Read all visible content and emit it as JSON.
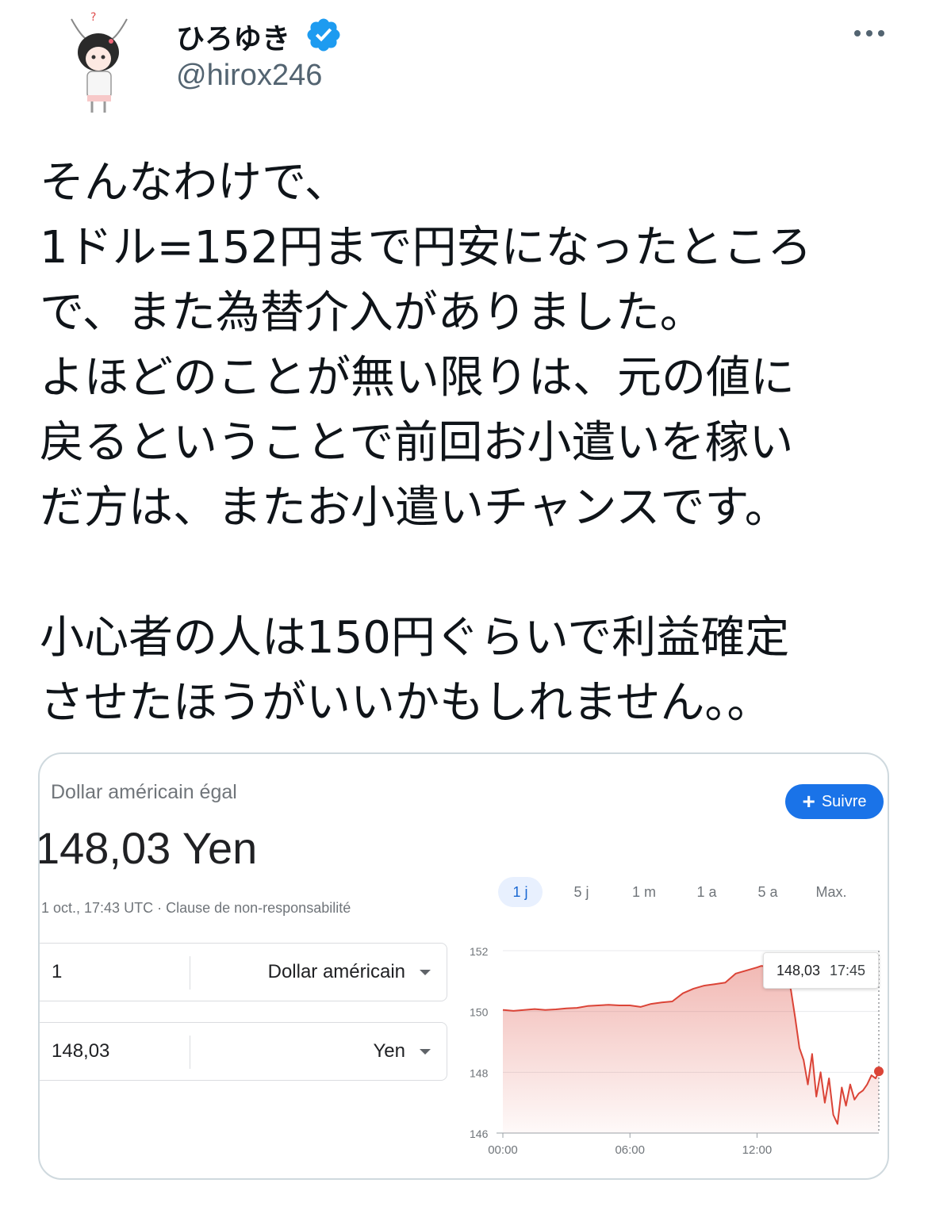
{
  "author": {
    "name": "ひろゆき",
    "handle": "@hirox246",
    "avatar_icon": "avatar-illustration",
    "verified_icon": "verified-badge-icon",
    "verified_color": "#1d9bf0"
  },
  "more_icon": "more-icon",
  "tweet": {
    "lines": [
      "そんなわけで、",
      "1ドル=152円まで円安になったところ",
      "で、また為替介入がありました。",
      "よほどのことが無い限りは、元の値に",
      "戻るということで前回お小遣いを稼い",
      "だ方は、またお小遣いチャンスです。",
      "",
      "小心者の人は150円ぐらいで利益確定",
      "させたほうがいいかもしれません。。"
    ]
  },
  "card": {
    "title": "Dollar américain égal",
    "price": "148,03 Yen",
    "timestamp": "1 oct., 17:43 UTC",
    "separator": " · ",
    "disclaimer": "Clause de non-responsabilité",
    "follow_label": "Suivre",
    "follow_color": "#1a73e8",
    "converter": [
      {
        "value": "1",
        "unit": "Dollar américain"
      },
      {
        "value": "148,03",
        "unit": "Yen"
      }
    ],
    "ranges": [
      "1 j",
      "5 j",
      "1 m",
      "1 a",
      "5 a",
      "Max."
    ],
    "active_range": "1 j",
    "tooltip": {
      "value": "148,03",
      "time": "17:45"
    }
  },
  "chart_data": {
    "type": "area",
    "color": "#db4437",
    "ylim": [
      146,
      152
    ],
    "yticks": [
      "152",
      "150",
      "148",
      "146"
    ],
    "xticks": [
      "00:00",
      "06:00",
      "12:00"
    ],
    "xrange_hours": [
      0,
      17.75
    ],
    "series": [
      {
        "x": [
          0,
          0.5,
          1,
          1.5,
          2,
          2.5,
          3,
          3.5,
          4,
          4.5,
          5,
          5.5,
          6,
          6.5,
          7,
          7.5,
          8,
          8.5,
          9,
          9.5,
          10,
          10.5,
          11,
          11.5,
          12,
          12.2,
          12.5,
          12.7,
          13,
          13.2,
          13.4,
          13.6,
          13.8,
          14,
          14.2,
          14.4,
          14.6,
          14.8,
          15,
          15.2,
          15.4,
          15.6,
          15.8,
          16,
          16.2,
          16.4,
          16.6,
          16.8,
          17,
          17.2,
          17.4,
          17.6,
          17.75
        ],
        "y": [
          150.05,
          150.02,
          150.05,
          150.08,
          150.05,
          150.07,
          150.1,
          150.12,
          150.18,
          150.2,
          150.22,
          150.2,
          150.2,
          150.15,
          150.25,
          150.3,
          150.33,
          150.6,
          150.75,
          150.85,
          150.9,
          150.95,
          151.25,
          151.35,
          151.45,
          151.5,
          151.48,
          151.6,
          151.55,
          151.4,
          151.2,
          150.7,
          149.8,
          148.8,
          148.4,
          147.6,
          148.6,
          147.2,
          148.0,
          147.0,
          147.8,
          146.6,
          146.3,
          147.5,
          146.9,
          147.6,
          147.1,
          147.3,
          147.4,
          147.6,
          147.9,
          147.8,
          148.03
        ]
      }
    ],
    "marked_point": {
      "x": 17.75,
      "y": 148.03
    },
    "hover_x": 17.75
  }
}
